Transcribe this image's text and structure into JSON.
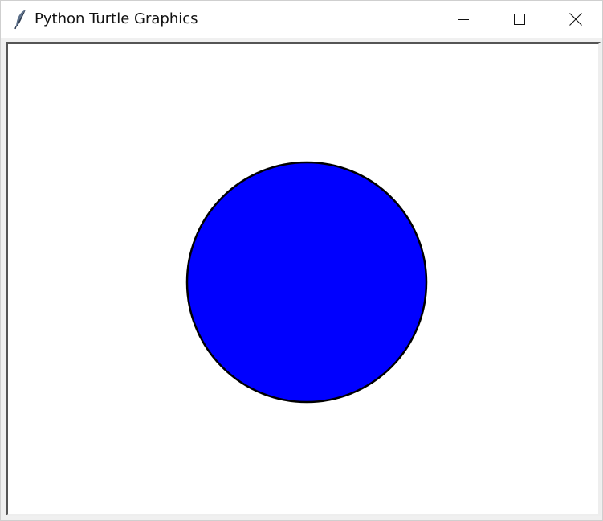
{
  "window": {
    "title": "Python Turtle Graphics",
    "app_icon": "feather-icon",
    "controls": {
      "minimize_icon": "minimize-icon",
      "maximize_icon": "maximize-icon",
      "close_icon": "close-icon"
    }
  },
  "canvas": {
    "background": "#ffffff",
    "shapes": [
      {
        "type": "circle",
        "fill": "#0000ff",
        "stroke": "#000000"
      }
    ]
  }
}
